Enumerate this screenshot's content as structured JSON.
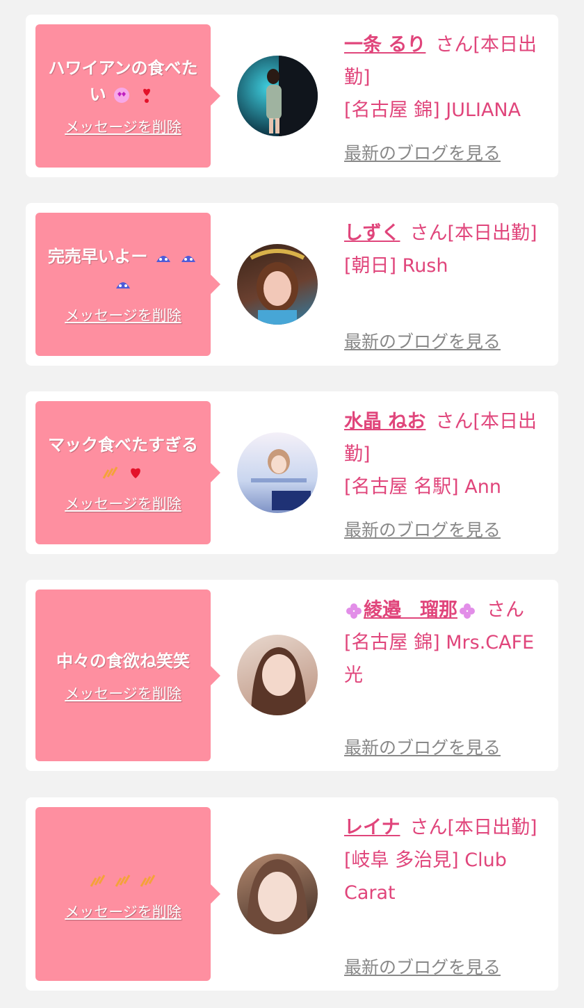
{
  "colors": {
    "bubble": "#fe8fa0",
    "accent": "#e0457b",
    "link_gray": "#888888",
    "card": "#ffffff",
    "background": "#f2f2f2"
  },
  "cards": [
    {
      "message": "ハワイアンの食べたい",
      "emojis": [
        "heart-eyes-icon",
        "red-exclamation-heart-icon"
      ],
      "delete_label": "メッセージを削除",
      "name": "一条 るり",
      "suffix": "さん[本日出勤]",
      "shop": "[名古屋 錦] JULIANA",
      "blog_label": "最新のブログを見る",
      "avatar": "woman-in-dress-photo"
    },
    {
      "message": "完売早いよー",
      "emojis": [
        "sweat-face-icon",
        "sweat-face-icon",
        "sweat-face-icon"
      ],
      "delete_label": "メッセージを削除",
      "name": "しずく",
      "suffix": "さん[本日出勤]",
      "shop": "[朝日] Rush",
      "blog_label": "最新のブログを見る",
      "avatar": "woman-selfie-photo"
    },
    {
      "message": "マック食べたすぎる",
      "emojis": [
        "sparkle-icon",
        "heart-sparkle-icon"
      ],
      "delete_label": "メッセージを削除",
      "name": "水晶 ねお",
      "suffix": "さん[本日出勤]",
      "shop": "[名古屋 名駅] Ann",
      "blog_label": "最新のブログを見る",
      "avatar": "no1-banner-photo"
    },
    {
      "message": "中々の食欲ね笑笑",
      "emojis": [],
      "delete_label": "メッセージを削除",
      "name": "綾邉　瑠那",
      "name_icon": "clover-icon",
      "suffix": "さん",
      "shop": "[名古屋 錦] Mrs.CAFE 光",
      "blog_label": "最新のブログを見る",
      "avatar": "woman-portrait-photo"
    },
    {
      "message": "",
      "emojis": [
        "sparkle-icon",
        "sparkle-icon",
        "sparkle-icon"
      ],
      "delete_label": "メッセージを削除",
      "name": "レイナ",
      "suffix": "さん[本日出勤]",
      "shop": "[岐阜 多治見] Club Carat",
      "blog_label": "最新のブログを見る",
      "avatar": "woman-closeup-photo"
    }
  ]
}
